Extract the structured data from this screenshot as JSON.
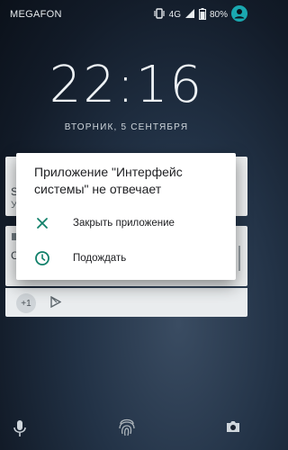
{
  "status_bar": {
    "carrier": "MEGAFON",
    "network": "4G",
    "battery": "80%",
    "icons": [
      "vibrate-icon",
      "signal-icon",
      "battery-icon",
      "account-icon"
    ]
  },
  "lockscreen": {
    "time": "22:16",
    "date": "ВТОРНИК, 5 СЕНТЯБРЯ"
  },
  "notifications_fragments": {
    "n1_line1": "S",
    "n1_line2": "У",
    "n2_line1": "С",
    "more_count": "+1"
  },
  "dialog": {
    "title": "Приложение \"Интерфейс системы\" не отвечает",
    "options": [
      {
        "label": "Закрыть приложение",
        "icon": "close-icon"
      },
      {
        "label": "Подождать",
        "icon": "clock-icon"
      }
    ]
  },
  "bottom_bar": {
    "icons": [
      "mic-icon",
      "fingerprint-icon",
      "camera-icon"
    ]
  },
  "colors": {
    "accent": "#11806a"
  }
}
